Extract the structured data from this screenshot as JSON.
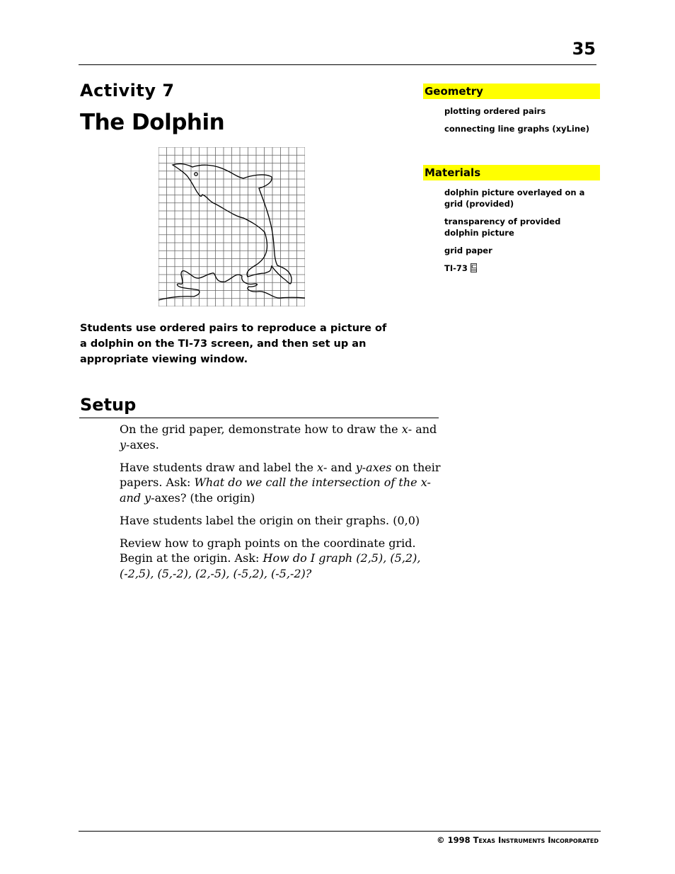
{
  "header": {
    "page_number": "35"
  },
  "activity": {
    "label": "Activity 7",
    "title": "The Dolphin"
  },
  "figure": {
    "description": "dolphin-outline-on-grid"
  },
  "summary": "Students use ordered pairs to reproduce a picture of a dolphin on the TI-73 screen, and then set up an appropriate viewing window.",
  "setup": {
    "heading": "Setup",
    "p1": {
      "a": "On the grid paper, demonstrate how to draw the ",
      "x": "x",
      "b": "- and ",
      "y": "y",
      "c": "-axes."
    },
    "p2": {
      "a": "Have students draw and label the ",
      "x": "x",
      "b": "- and ",
      "yaxes": "y-axes",
      "c": " on their papers. Ask:  ",
      "q1": "What do we call the intersection of the ",
      "qx": "x",
      "q2": "- and ",
      "qy": "y",
      "d": "-axes? (the origin)"
    },
    "p3": "Have students label the origin on their graphs. (0,0)",
    "p4": {
      "a": "Review how to graph points on the coordinate grid. Begin at the origin. Ask:  ",
      "q": "How do I graph (2,5), (5,2), (-2,5), (5,-2), (2,-5), (-5,2), (-5,-2)?"
    }
  },
  "sidebar": {
    "geometry": {
      "header": "Geometry",
      "items": [
        "plotting  ordered pairs",
        "connecting line graphs (xyLine)"
      ]
    },
    "materials": {
      "header": "Materials",
      "items": [
        "dolphin picture overlayed on a grid (provided)",
        "transparency of provided dolphin picture",
        "grid paper",
        "TI-73"
      ],
      "calculator_icon": "calculator-icon"
    },
    "highlight_color": "#ffff00"
  },
  "footer": {
    "copyright": "© 1998 Texas Instruments Incorporated"
  }
}
